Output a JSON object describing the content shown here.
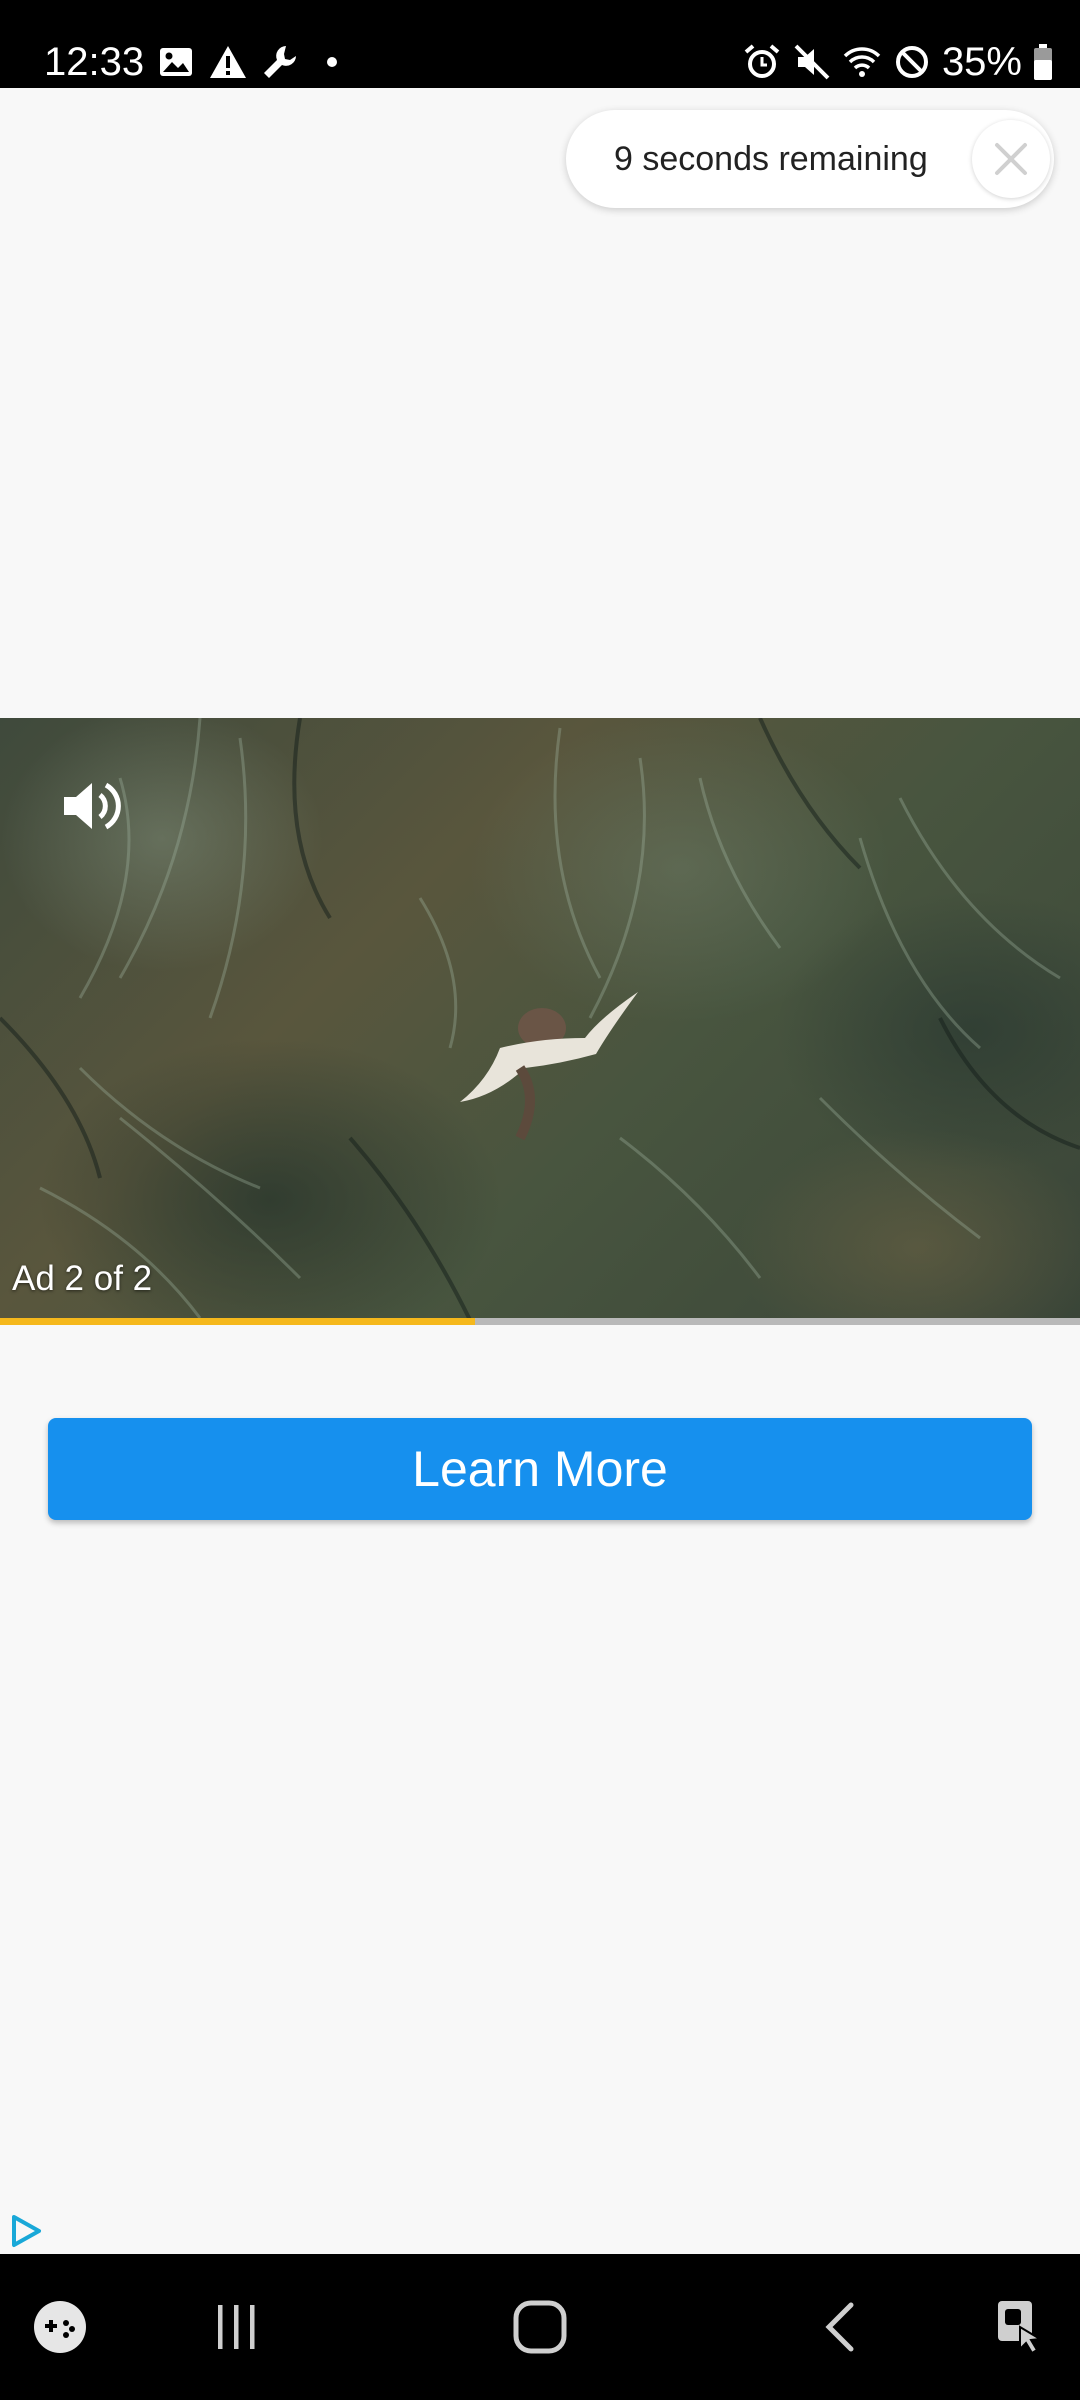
{
  "status_bar": {
    "time": "12:33",
    "left_icons": [
      "image-icon",
      "warning-icon",
      "wrench-icon",
      "dot-icon"
    ],
    "right_icons": [
      "alarm-icon",
      "mute-icon",
      "wifi-icon",
      "dnd-icon",
      "battery-icon"
    ],
    "battery": "35%"
  },
  "ad_timer": {
    "text": "9 seconds remaining",
    "close_icon": "close-icon"
  },
  "video": {
    "sound_icon": "volume-icon",
    "ad_counter": "Ad 2 of 2",
    "progress_fraction": 0.44,
    "progress_color": "#f5b81c",
    "track_color": "#b9b9b9"
  },
  "cta": {
    "label": "Learn More",
    "color": "#1690ee"
  },
  "ad_logo": "play-logo-icon",
  "nav_bar": {
    "items": [
      "game-launcher-icon",
      "recent-apps-icon",
      "home-icon",
      "back-icon",
      "accessibility-icon"
    ]
  }
}
